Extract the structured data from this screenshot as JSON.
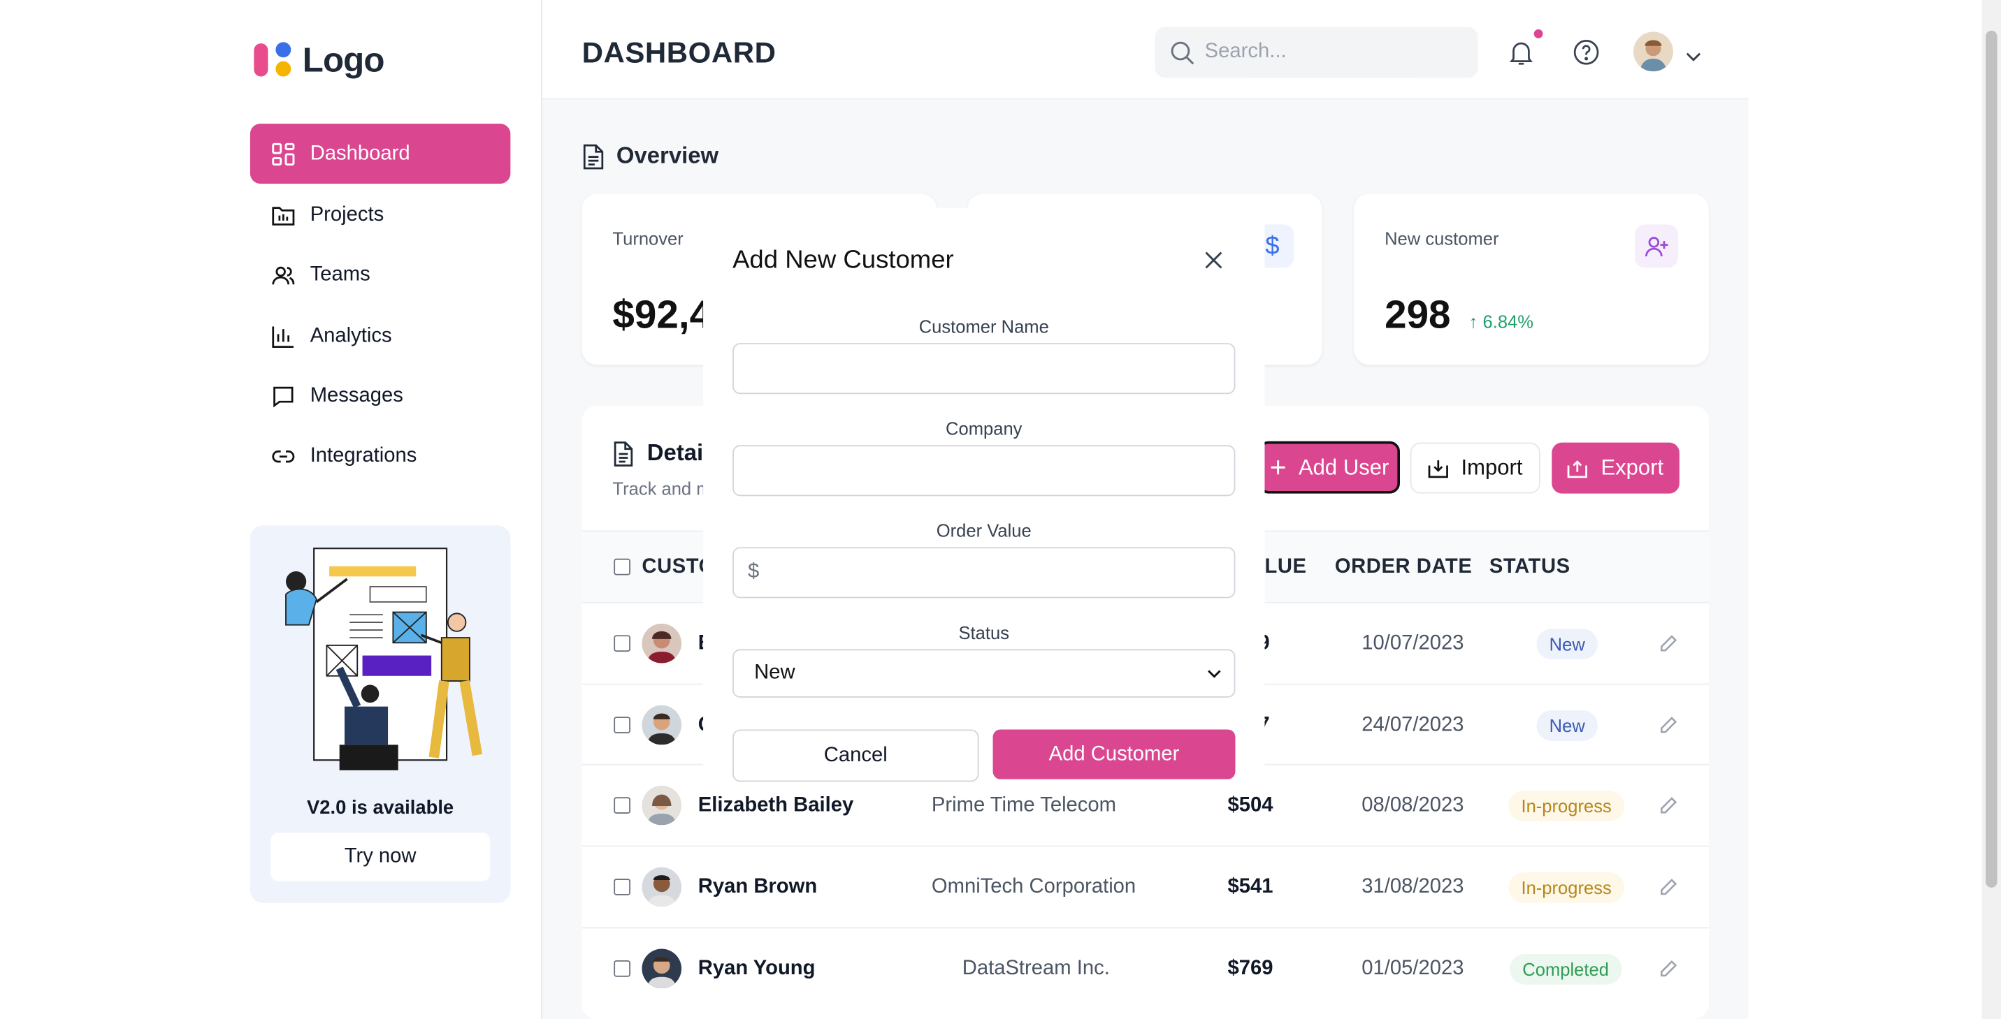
{
  "logo": {
    "text": "Logo"
  },
  "nav": [
    {
      "label": "Dashboard",
      "icon": "grid-icon",
      "active": true
    },
    {
      "label": "Projects",
      "icon": "folder-chart-icon"
    },
    {
      "label": "Teams",
      "icon": "users-icon"
    },
    {
      "label": "Analytics",
      "icon": "bar-chart-icon"
    },
    {
      "label": "Messages",
      "icon": "message-icon"
    },
    {
      "label": "Integrations",
      "icon": "link-icon"
    }
  ],
  "promo": {
    "title": "V2.0 is available",
    "button": "Try now"
  },
  "header": {
    "title": "DASHBOARD",
    "search_placeholder": "Search..."
  },
  "overview": {
    "title": "Overview",
    "cards": [
      {
        "label": "Turnover",
        "value": "$92,4"
      },
      {
        "label": "New customer",
        "value": "298",
        "change": "↑ 6.84%"
      }
    ]
  },
  "table": {
    "title": "Detai",
    "subtitle": "Track and m",
    "buttons": {
      "add_user": "Add User",
      "import": "Import",
      "export": "Export"
    },
    "headers": {
      "customer": "CUSTO",
      "value": "LUE",
      "order_date": "ORDER DATE",
      "status": "STATUS"
    },
    "rows": [
      {
        "name": "E",
        "company": "",
        "value": "9",
        "date": "10/07/2023",
        "status": "New",
        "status_type": "new"
      },
      {
        "name": "C",
        "company": "",
        "value": "7",
        "date": "24/07/2023",
        "status": "New",
        "status_type": "new"
      },
      {
        "name": "Elizabeth Bailey",
        "company": "Prime Time Telecom",
        "value": "$504",
        "date": "08/08/2023",
        "status": "In-progress",
        "status_type": "prog"
      },
      {
        "name": "Ryan Brown",
        "company": "OmniTech Corporation",
        "value": "$541",
        "date": "31/08/2023",
        "status": "In-progress",
        "status_type": "prog"
      },
      {
        "name": "Ryan Young",
        "company": "DataStream Inc.",
        "value": "$769",
        "date": "01/05/2023",
        "status": "Completed",
        "status_type": "done"
      }
    ]
  },
  "modal": {
    "title": "Add New Customer",
    "fields": {
      "customer_name": {
        "label": "Customer Name",
        "value": ""
      },
      "company": {
        "label": "Company",
        "value": ""
      },
      "order_value": {
        "label": "Order Value",
        "prefix": "$"
      },
      "status": {
        "label": "Status",
        "selected": "New"
      }
    },
    "cancel": "Cancel",
    "submit": "Add Customer"
  },
  "colors": {
    "accent": "#db4690",
    "new": "#3b5bb5",
    "progress": "#b7861b",
    "completed": "#2f9b55",
    "up": "#22a06b"
  }
}
